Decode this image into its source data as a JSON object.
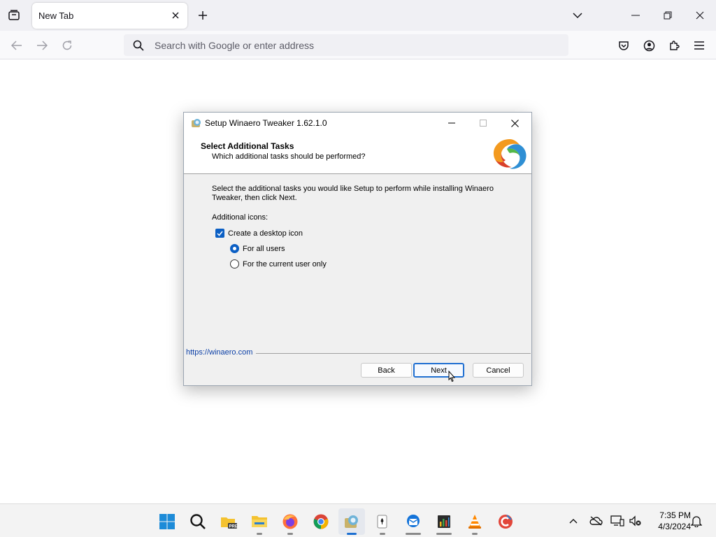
{
  "browser": {
    "tab_title": "New Tab",
    "url_placeholder": "Search with Google or enter address"
  },
  "dialog": {
    "window_title": "Setup Winaero Tweaker 1.62.1.0",
    "header_title": "Select Additional Tasks",
    "header_subtitle": "Which additional tasks should be performed?",
    "description": "Select the additional tasks you would like Setup to perform while installing Winaero Tweaker, then click Next.",
    "icons_label": "Additional icons:",
    "desktop_icon": {
      "label": "Create a desktop icon",
      "checked": true
    },
    "options": [
      {
        "label": "For all users",
        "selected": true
      },
      {
        "label": "For the current user only",
        "selected": false
      }
    ],
    "footer_link": "https://winaero.com",
    "buttons": {
      "back": "Back",
      "next": "Next",
      "cancel": "Cancel"
    }
  },
  "taskbar": {
    "apps": [
      "start-icon",
      "search-icon",
      "file-explorer-preview-icon",
      "file-explorer-icon",
      "firefox-icon",
      "chrome-icon",
      "winaero-setup-icon",
      "solitaire-icon",
      "thunderbird-icon",
      "task-manager-icon",
      "vlc-icon",
      "ccleaner-icon"
    ],
    "clock_time": "7:35 PM",
    "clock_date": "4/3/2024"
  },
  "colors": {
    "accent": "#0b5fc4",
    "link": "#0b3fa6",
    "dialog_bg": "#f0f0f0",
    "browser_bg": "#f0f0f4"
  }
}
